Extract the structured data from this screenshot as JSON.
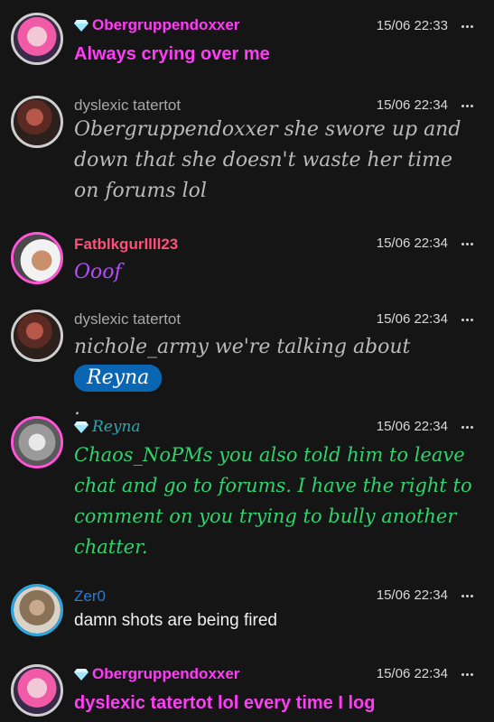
{
  "messages": [
    {
      "username": "Obergruppendoxxer",
      "username_color": "#ff3df7",
      "badge": "diamond-icon",
      "time": "15/06 22:33",
      "text": "Always crying over me"
    },
    {
      "username": "dyslexic tatertot",
      "username_color": "#a8a8a8",
      "time": "15/06 22:34",
      "text": "Obergruppendoxxer she swore up and down that she doesn't waste her time on forums lol"
    },
    {
      "username": "Fatblkgurllll23",
      "username_color": "#ff4f7a",
      "time": "15/06 22:34",
      "text": "Ooof"
    },
    {
      "username": "dyslexic tatertot",
      "username_color": "#a8a8a8",
      "time": "15/06 22:34",
      "text_before": "nichole_army we're talking about",
      "mention": "Reyna",
      "text_after": "."
    },
    {
      "username": "Reyna",
      "username_color": "#2aa7b5",
      "badge": "diamond-icon",
      "time": "15/06 22:34",
      "text": "Chaos_NoPMs you also told him to leave chat and go to forums. I have the right to comment on you trying to bully another chatter."
    },
    {
      "username": "Zer0",
      "username_color": "#1f7ee0",
      "time": "15/06 22:34",
      "text": "damn shots are being fired"
    },
    {
      "username": "Obergruppendoxxer",
      "username_color": "#ff3df7",
      "badge": "diamond-icon",
      "time": "15/06 22:34",
      "text": "dyslexic tatertot lol every time I log"
    }
  ]
}
